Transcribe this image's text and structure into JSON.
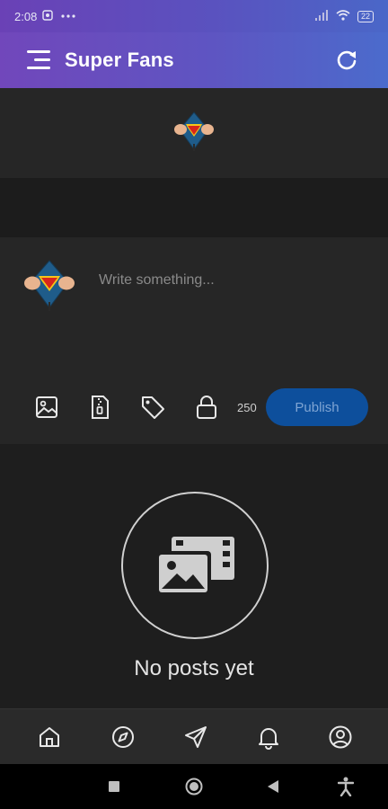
{
  "status_bar": {
    "time": "2:08",
    "battery": "22"
  },
  "app_bar": {
    "title": "Super Fans"
  },
  "composer": {
    "placeholder": "Write something...",
    "char_count": "250",
    "publish_label": "Publish"
  },
  "empty_state": {
    "message": "No posts yet"
  },
  "icons": {
    "menu": "menu-icon",
    "refresh": "refresh-icon",
    "image": "image-icon",
    "zip": "zip-file-icon",
    "tag": "tag-icon",
    "lock": "lock-icon",
    "home": "home-icon",
    "explore": "compass-icon",
    "send": "send-icon",
    "notifications": "bell-icon",
    "profile": "profile-icon"
  },
  "colors": {
    "header_start": "#6a41b6",
    "header_end": "#4a67c8",
    "publish": "#0d4f9c",
    "background": "#1e1e1e"
  }
}
